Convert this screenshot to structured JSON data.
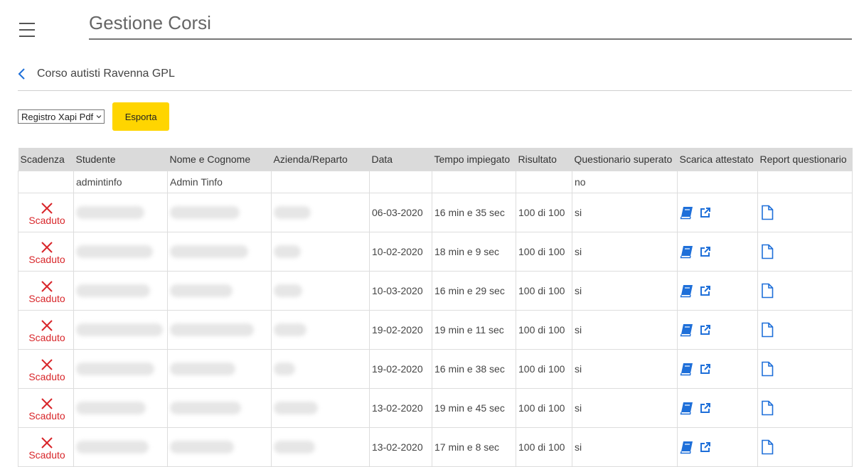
{
  "header": {
    "title": "Gestione Corsi",
    "menu_icon": "hamburger-icon"
  },
  "breadcrumb": {
    "back_icon": "chevron-left-icon",
    "course_title": "Corso autisti Ravenna GPL"
  },
  "controls": {
    "select_value": "Registro Xapi Pdf",
    "export_label": "Esporta"
  },
  "table": {
    "columns": [
      "Scadenza",
      "Studente",
      "Nome e Cognome",
      "Azienda/Reparto",
      "Data",
      "Tempo impiegato",
      "Risultato",
      "Questionario superato",
      "Scarica attestato",
      "Report questionario"
    ],
    "admin_row": {
      "student": "admintinfo",
      "name": "Admin Tinfo",
      "passed": "no"
    },
    "expired_label": "Scaduto",
    "rows": [
      {
        "date": "06-03-2020",
        "time": "16 min e 35 sec",
        "result": "100 di 100",
        "passed": "si"
      },
      {
        "date": "10-02-2020",
        "time": "18 min e 9 sec",
        "result": "100 di 100",
        "passed": "si"
      },
      {
        "date": "10-03-2020",
        "time": "16 min e 29 sec",
        "result": "100 di 100",
        "passed": "si"
      },
      {
        "date": "19-02-2020",
        "time": "19 min e 11 sec",
        "result": "100 di 100",
        "passed": "si"
      },
      {
        "date": "19-02-2020",
        "time": "16 min e 38 sec",
        "result": "100 di 100",
        "passed": "si"
      },
      {
        "date": "13-02-2020",
        "time": "19 min e 45 sec",
        "result": "100 di 100",
        "passed": "si"
      },
      {
        "date": "13-02-2020",
        "time": "17 min e 8 sec",
        "result": "100 di 100",
        "passed": "si"
      }
    ]
  },
  "colors": {
    "accent_yellow": "#ffd500",
    "expired_red": "#d8262a",
    "icon_blue": "#1e6fd9",
    "header_gray": "#dadada"
  }
}
